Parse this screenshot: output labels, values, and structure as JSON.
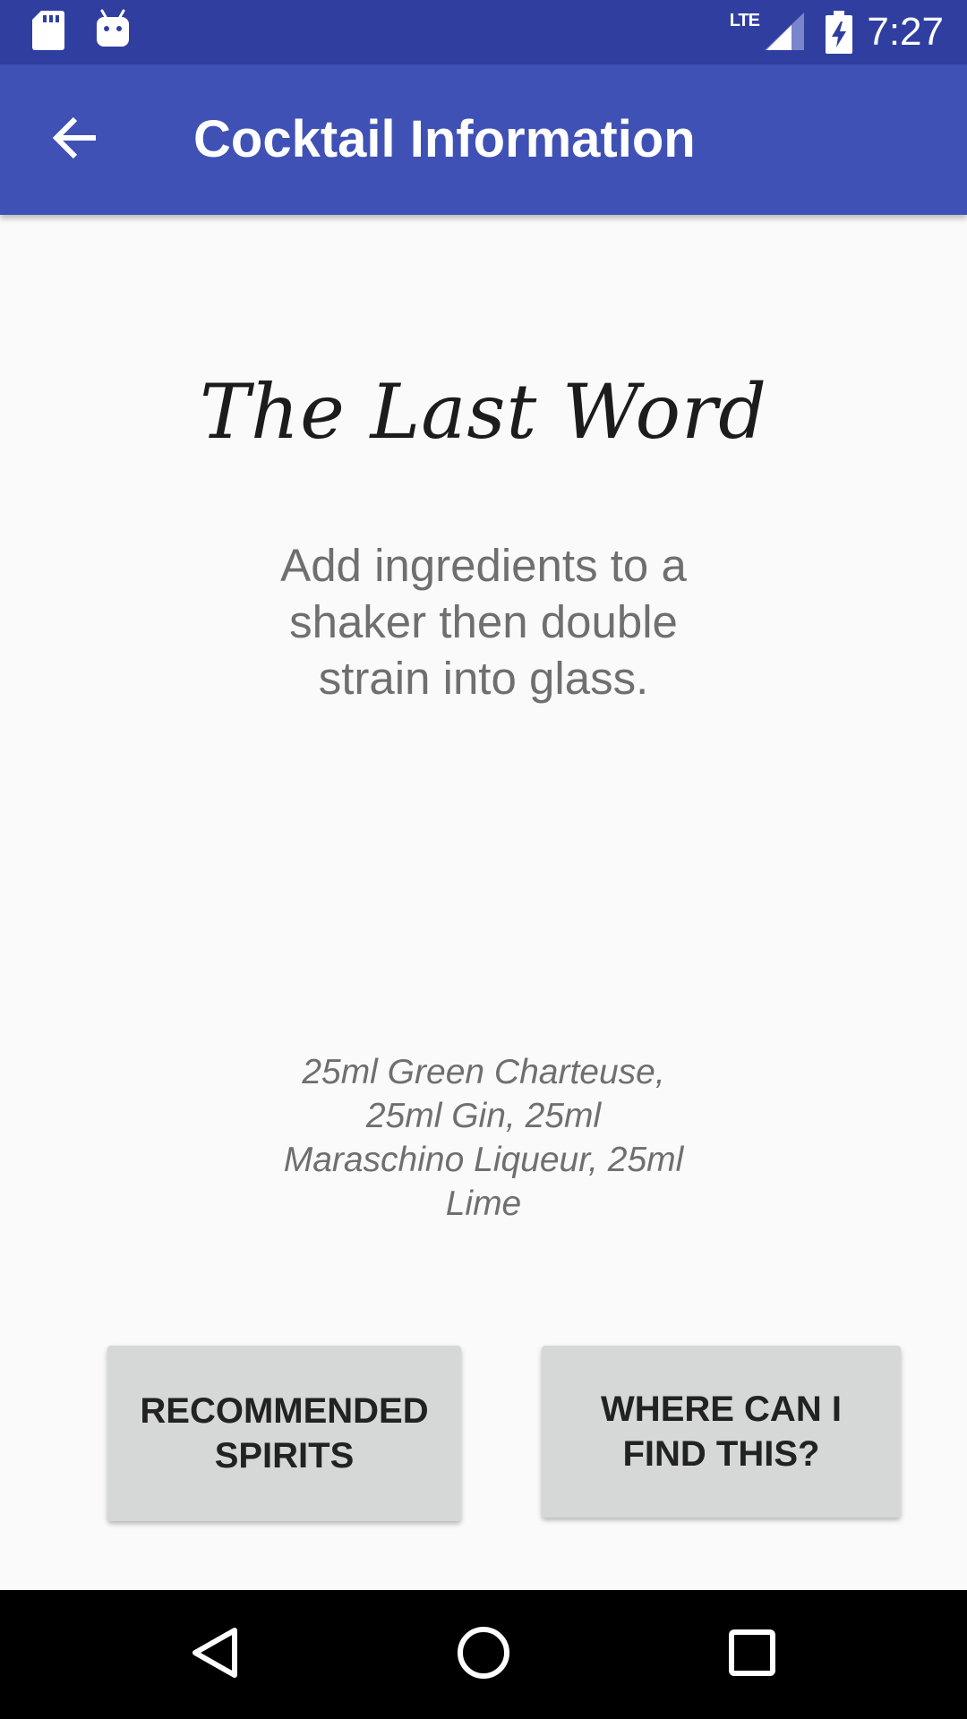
{
  "status_bar": {
    "time": "7:27",
    "network": "LTE",
    "icons": [
      "sd-card-icon",
      "android-debug-icon",
      "lte-signal-icon",
      "battery-charging-icon"
    ]
  },
  "app_bar": {
    "title": "Cocktail Information",
    "back_icon": "arrow-back-icon"
  },
  "cocktail": {
    "name": "The Last Word",
    "instructions": "Add ingredients to a shaker then double strain into glass.",
    "ingredients": "25ml Green Charteuse, 25ml Gin, 25ml Maraschino Liqueur, 25ml Lime"
  },
  "buttons": {
    "recommended_spirits": "RECOMMENDED\nSPIRITS",
    "where_to_find": "WHERE CAN I\nFIND THIS?"
  },
  "nav_bar": {
    "icons": [
      "back-triangle-icon",
      "home-circle-icon",
      "recents-square-icon"
    ]
  },
  "colors": {
    "status_bar": "#303f9f",
    "app_bar": "#3f51b5",
    "background": "#fafafa",
    "button": "#d6d7d7",
    "secondary_text": "#6f6f6f"
  }
}
